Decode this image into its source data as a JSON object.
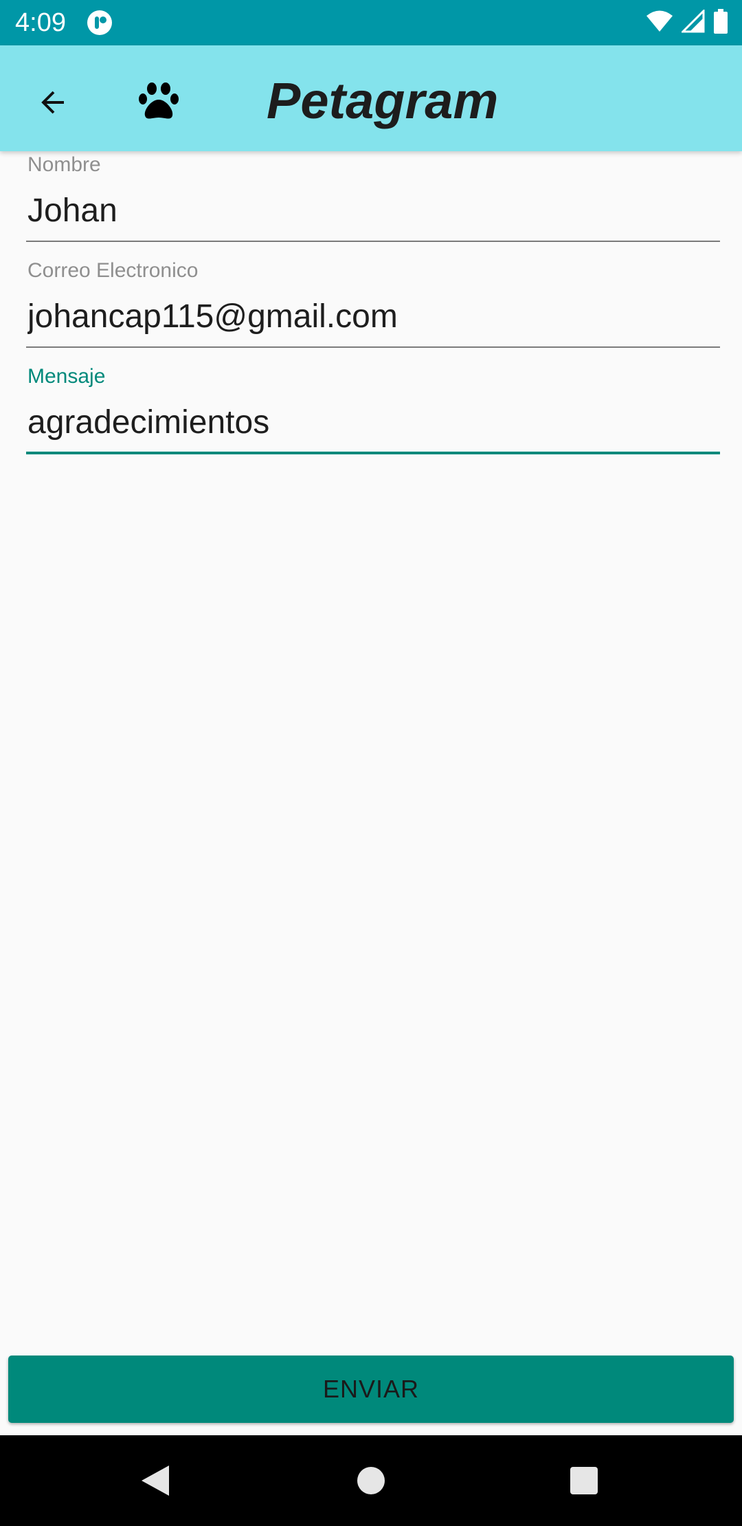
{
  "status_bar": {
    "time": "4:09",
    "icons": [
      "app-notification-icon",
      "wifi-icon",
      "cellular-signal-icon",
      "battery-icon"
    ]
  },
  "app_bar": {
    "title": "Petagram",
    "icons": [
      "back-arrow-icon",
      "paw-icon"
    ]
  },
  "form": {
    "fields": [
      {
        "label": "Nombre",
        "value": "Johan",
        "focused": false
      },
      {
        "label": "Correo Electronico",
        "value": "johancap115@gmail.com",
        "focused": false
      },
      {
        "label": "Mensaje",
        "value": "agradecimientos",
        "focused": true
      }
    ]
  },
  "send_button": {
    "label": "ENVIAR"
  },
  "nav_bar": {
    "icons": [
      "nav-back-icon",
      "nav-home-icon",
      "nav-recents-icon"
    ]
  },
  "colors": {
    "status_bar": "#0097a7",
    "app_bar": "#84e3ec",
    "accent": "#00897b",
    "background": "#fafafa"
  }
}
